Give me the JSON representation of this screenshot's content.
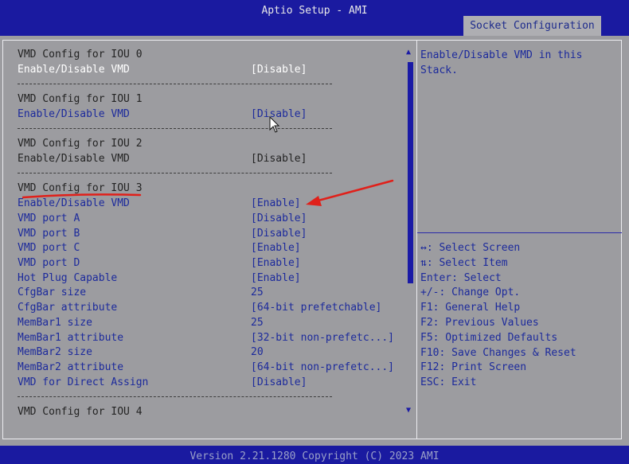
{
  "app_title": "Aptio Setup - AMI",
  "active_tab": "Socket Configuration",
  "items": [
    {
      "label": "VMD Config for IOU 0",
      "value": "",
      "style": "hdr"
    },
    {
      "label": "Enable/Disable VMD",
      "value": "[Disable]",
      "style": "sel"
    },
    {
      "label": "VMD Config for IOU 1",
      "value": "",
      "style": "hdr"
    },
    {
      "label": "Enable/Disable VMD",
      "value": "[Disable]",
      "style": "act"
    },
    {
      "label": "VMD Config for IOU 2",
      "value": "",
      "style": "hdr"
    },
    {
      "label": "Enable/Disable VMD",
      "value": "[Disable]",
      "style": "stat"
    },
    {
      "label": "VMD Config for IOU 3",
      "value": "",
      "style": "hdr"
    },
    {
      "label": "Enable/Disable VMD",
      "value": "[Enable]",
      "style": "act"
    },
    {
      "label": "VMD port A",
      "value": "[Disable]",
      "style": "act"
    },
    {
      "label": "VMD port B",
      "value": "[Disable]",
      "style": "act"
    },
    {
      "label": "VMD port C",
      "value": "[Enable]",
      "style": "act"
    },
    {
      "label": "VMD port D",
      "value": "[Enable]",
      "style": "act"
    },
    {
      "label": "Hot Plug Capable",
      "value": "[Enable]",
      "style": "act"
    },
    {
      "label": "CfgBar size",
      "value": "25",
      "style": "act"
    },
    {
      "label": "CfgBar attribute",
      "value": "[64-bit prefetchable]",
      "style": "act"
    },
    {
      "label": "MemBar1 size",
      "value": "25",
      "style": "act"
    },
    {
      "label": "MemBar1 attribute",
      "value": "[32-bit non-prefetc...]",
      "style": "act"
    },
    {
      "label": "MemBar2 size",
      "value": "20",
      "style": "act"
    },
    {
      "label": "MemBar2 attribute",
      "value": "[64-bit non-prefetc...]",
      "style": "act"
    },
    {
      "label": "VMD for Direct Assign",
      "value": "[Disable]",
      "style": "act"
    },
    {
      "label": "VMD Config for IOU 4",
      "value": "",
      "style": "hdr"
    }
  ],
  "help_text": "Enable/Disable VMD in this Stack.",
  "keys": [
    "↔: Select Screen",
    "⇅: Select Item",
    "Enter: Select",
    "+/-: Change Opt.",
    "F1: General Help",
    "F2: Previous Values",
    "F5: Optimized Defaults",
    "F10: Save Changes & Reset",
    "F12: Print Screen",
    "ESC: Exit"
  ],
  "version_text": "Version 2.21.1280 Copyright (C) 2023 AMI",
  "colors": {
    "bar": "#1a1aa0",
    "background": "#9c9ca0",
    "active_text": "#1c2a9c",
    "annotation": "#e0201a"
  }
}
